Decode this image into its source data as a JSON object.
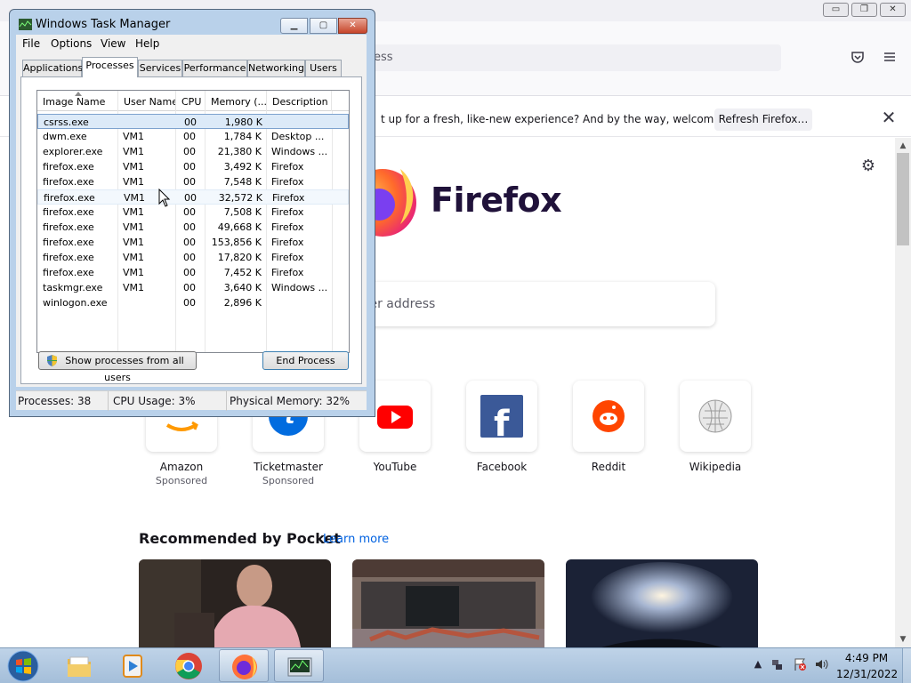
{
  "firefox": {
    "window_buttons": {
      "minimize": "▭",
      "restore": "❐",
      "close": "✕"
    },
    "urlbar_text": "ess",
    "notice": {
      "text": "t up for a fresh, like-new experience? And by the way, welcome back!",
      "refresh_label": "Refresh Firefox…",
      "close_glyph": "✕"
    },
    "wordmark": "Firefox",
    "search_placeholder": "ter address",
    "top_sites": [
      {
        "label": "Amazon",
        "sponsored": "Sponsored",
        "icon": "amazon-icon"
      },
      {
        "label": "Ticketmaster",
        "sponsored": "Sponsored",
        "icon": "ticketmaster-icon"
      },
      {
        "label": "YouTube",
        "sponsored": "",
        "icon": "youtube-icon"
      },
      {
        "label": "Facebook",
        "sponsored": "",
        "icon": "facebook-icon"
      },
      {
        "label": "Reddit",
        "sponsored": "",
        "icon": "reddit-icon"
      },
      {
        "label": "Wikipedia",
        "sponsored": "",
        "icon": "wikipedia-icon"
      }
    ],
    "pocket": {
      "title": "Recommended by Pocket",
      "learn_more": "Learn more"
    }
  },
  "task_manager": {
    "title": "Windows Task Manager",
    "menu": [
      "File",
      "Options",
      "View",
      "Help"
    ],
    "tabs": [
      "Applications",
      "Processes",
      "Services",
      "Performance",
      "Networking",
      "Users"
    ],
    "active_tab": "Processes",
    "columns": [
      "Image Name",
      "User Name",
      "CPU",
      "Memory (...",
      "Description"
    ],
    "processes": [
      {
        "name": "csrss.exe",
        "user": "",
        "cpu": "00",
        "memory": "1,980 K",
        "description": ""
      },
      {
        "name": "dwm.exe",
        "user": "VM1",
        "cpu": "00",
        "memory": "1,784 K",
        "description": "Desktop ..."
      },
      {
        "name": "explorer.exe",
        "user": "VM1",
        "cpu": "00",
        "memory": "21,380 K",
        "description": "Windows ..."
      },
      {
        "name": "firefox.exe",
        "user": "VM1",
        "cpu": "00",
        "memory": "3,492 K",
        "description": "Firefox"
      },
      {
        "name": "firefox.exe",
        "user": "VM1",
        "cpu": "00",
        "memory": "7,548 K",
        "description": "Firefox"
      },
      {
        "name": "firefox.exe",
        "user": "VM1",
        "cpu": "00",
        "memory": "32,572 K",
        "description": "Firefox"
      },
      {
        "name": "firefox.exe",
        "user": "VM1",
        "cpu": "00",
        "memory": "7,508 K",
        "description": "Firefox"
      },
      {
        "name": "firefox.exe",
        "user": "VM1",
        "cpu": "00",
        "memory": "49,668 K",
        "description": "Firefox"
      },
      {
        "name": "firefox.exe",
        "user": "VM1",
        "cpu": "00",
        "memory": "153,856 K",
        "description": "Firefox"
      },
      {
        "name": "firefox.exe",
        "user": "VM1",
        "cpu": "00",
        "memory": "17,820 K",
        "description": "Firefox"
      },
      {
        "name": "firefox.exe",
        "user": "VM1",
        "cpu": "00",
        "memory": "7,452 K",
        "description": "Firefox"
      },
      {
        "name": "taskmgr.exe",
        "user": "VM1",
        "cpu": "00",
        "memory": "3,640 K",
        "description": "Windows ..."
      },
      {
        "name": "winlogon.exe",
        "user": "",
        "cpu": "00",
        "memory": "2,896 K",
        "description": ""
      }
    ],
    "selected_row": 0,
    "hover_row": 5,
    "show_all_label": "Show processes from all users",
    "end_process_label": "End Process",
    "status": {
      "processes": "Processes: 38",
      "cpu": "CPU Usage: 3%",
      "memory": "Physical Memory: 32%"
    }
  },
  "taskbar": {
    "items": [
      "windows-explorer-icon",
      "media-player-icon",
      "chrome-icon",
      "firefox-icon",
      "task-manager-icon"
    ],
    "active_items": [
      "firefox-icon",
      "task-manager-icon"
    ],
    "tray": {
      "arrow": "▲"
    },
    "time": "4:49 PM",
    "date": "12/31/2022"
  }
}
